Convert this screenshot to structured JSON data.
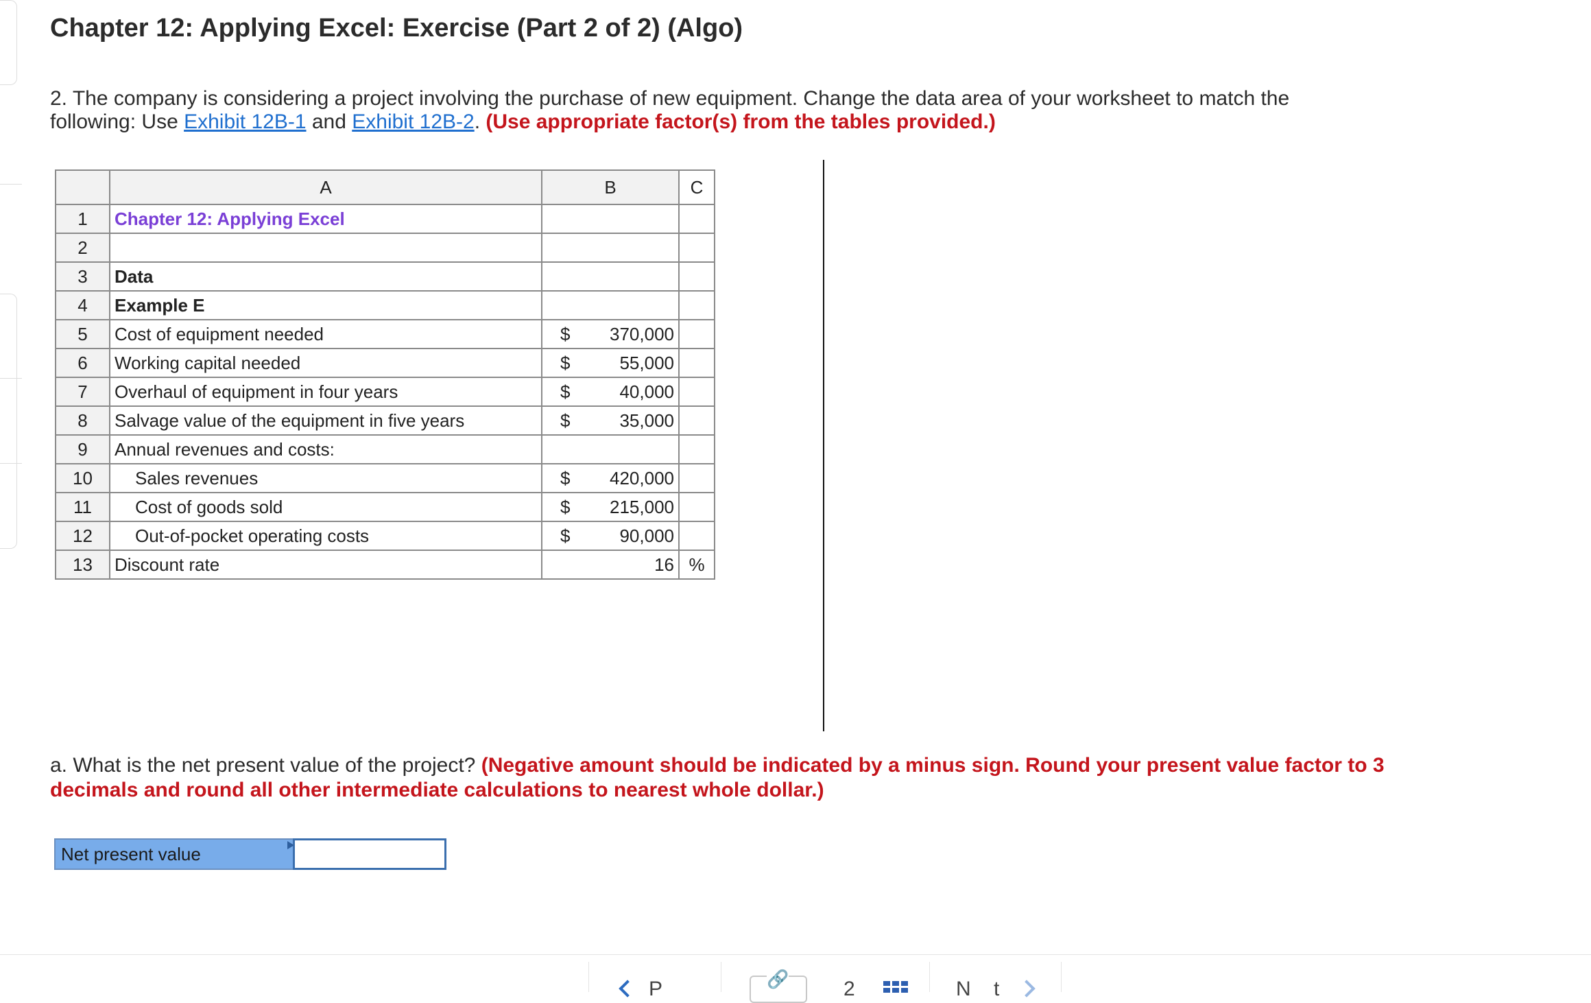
{
  "title": "Chapter 12: Applying Excel: Exercise (Part 2 of 2) (Algo)",
  "question": {
    "intro": "2. The company is considering a project involving the purchase of new equipment. Change the data area of your worksheet to match the following: Use ",
    "link1": "Exhibit 12B-1",
    "and": " and ",
    "link2": "Exhibit 12B-2",
    "period": ". ",
    "instruction": "(Use appropriate factor(s) from the tables provided.)"
  },
  "sheet": {
    "col_headers": [
      "A",
      "B",
      "C"
    ],
    "rows": [
      {
        "num": "1",
        "a": "Chapter 12: Applying Excel",
        "cur": "",
        "val": "",
        "c": ""
      },
      {
        "num": "2",
        "a": "",
        "cur": "",
        "val": "",
        "c": ""
      },
      {
        "num": "3",
        "a": "Data",
        "cur": "",
        "val": "",
        "c": ""
      },
      {
        "num": "4",
        "a": "Example E",
        "cur": "",
        "val": "",
        "c": ""
      },
      {
        "num": "5",
        "a": "Cost of equipment needed",
        "cur": "$",
        "val": "370,000",
        "c": ""
      },
      {
        "num": "6",
        "a": "Working capital needed",
        "cur": "$",
        "val": "55,000",
        "c": ""
      },
      {
        "num": "7",
        "a": "Overhaul of equipment in four years",
        "cur": "$",
        "val": "40,000",
        "c": ""
      },
      {
        "num": "8",
        "a": "Salvage value of the equipment in five years",
        "cur": "$",
        "val": "35,000",
        "c": ""
      },
      {
        "num": "9",
        "a": "Annual revenues and costs:",
        "cur": "",
        "val": "",
        "c": ""
      },
      {
        "num": "10",
        "a": "Sales revenues",
        "cur": "$",
        "val": "420,000",
        "c": ""
      },
      {
        "num": "11",
        "a": "Cost of goods sold",
        "cur": "$",
        "val": "215,000",
        "c": ""
      },
      {
        "num": "12",
        "a": "Out-of-pocket operating costs",
        "cur": "$",
        "val": "90,000",
        "c": ""
      },
      {
        "num": "13",
        "a": "Discount rate",
        "cur": "",
        "val": "16",
        "c": "%"
      }
    ]
  },
  "question_a": {
    "text": "a. What is the net present value of the project? ",
    "instruction": "(Negative amount should be indicated by a minus sign. Round your present value factor to 3 decimals and round all other intermediate calculations to nearest whole dollar.)"
  },
  "answer": {
    "label": "Net present value",
    "value": ""
  },
  "footer": {
    "prev_partial": "P",
    "page_partial": "2",
    "next_partial": "N    t"
  },
  "colors": {
    "link": "#1f6fcf",
    "instruction_red": "#c4151c",
    "excel_title_purple": "#7a3fd6",
    "answer_label_bg": "#78acea"
  }
}
